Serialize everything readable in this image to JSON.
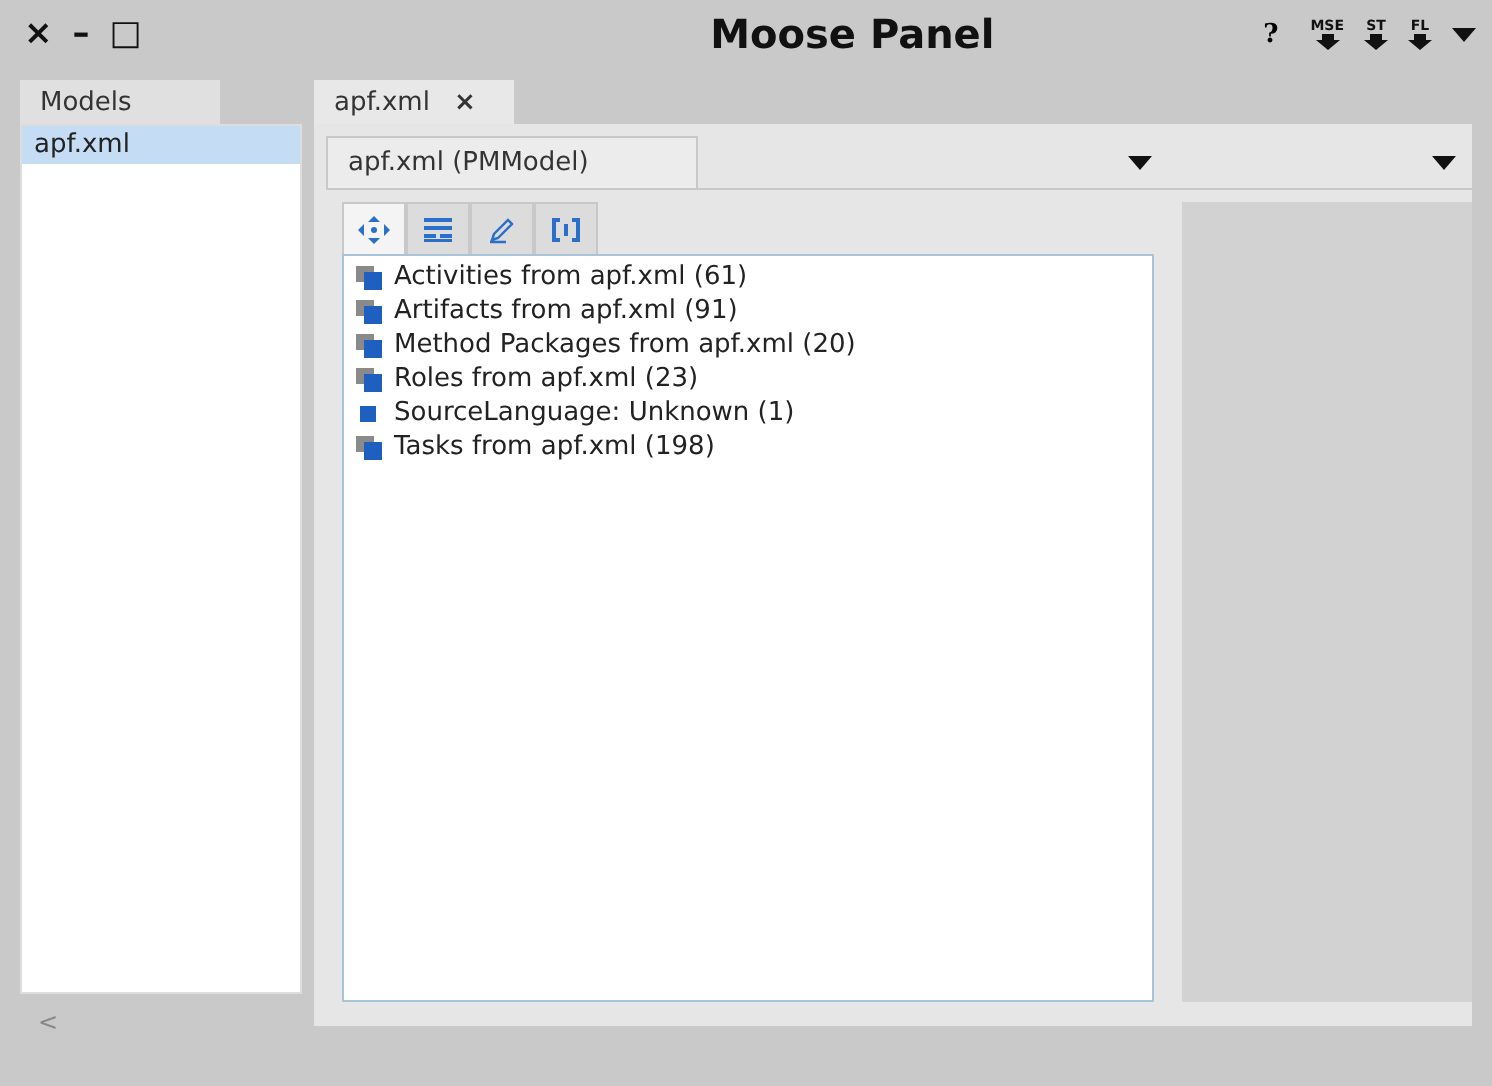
{
  "window": {
    "title": "Moose Panel",
    "controls": [
      "×",
      "–",
      "□"
    ],
    "help": "?",
    "actions": [
      {
        "label": "MSE"
      },
      {
        "label": "ST"
      },
      {
        "label": "FL"
      }
    ]
  },
  "models_panel": {
    "tab": "Models",
    "items": [
      {
        "label": "apf.xml",
        "selected": true
      }
    ]
  },
  "editor_tabs": [
    {
      "label": "apf.xml",
      "close": "×",
      "selected": true
    }
  ],
  "sub_tabs": [
    {
      "label": "apf.xml (PMModel)",
      "selected": true
    }
  ],
  "tool_buttons": [
    {
      "kind": "move",
      "selected": true
    },
    {
      "kind": "table",
      "selected": false
    },
    {
      "kind": "pen",
      "selected": false
    },
    {
      "kind": "brackets",
      "selected": false
    }
  ],
  "groups": [
    {
      "label": "Activities from apf.xml (61)",
      "kind": "group"
    },
    {
      "label": "Artifacts from apf.xml (91)",
      "kind": "group"
    },
    {
      "label": "Method Packages from apf.xml (20)",
      "kind": "group"
    },
    {
      "label": "Roles from apf.xml (23)",
      "kind": "group"
    },
    {
      "label": "SourceLanguage: Unknown (1)",
      "kind": "single"
    },
    {
      "label": "Tasks from apf.xml (198)",
      "kind": "group"
    }
  ],
  "scroll_left": "<"
}
